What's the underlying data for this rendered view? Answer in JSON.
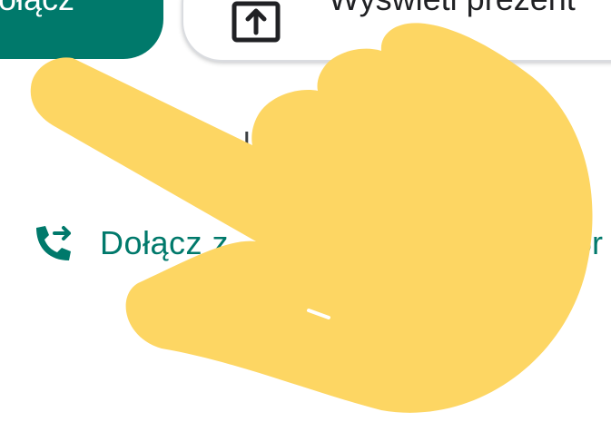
{
  "join_button": {
    "label": "ołącz"
  },
  "present_button": {
    "label": "Wyświetl prezent",
    "icon": "present-screen-icon"
  },
  "divider": {
    "text": "l"
  },
  "phone_join": {
    "label": "Dołącz z",
    "tail": "or",
    "icon": "phone-forward-icon"
  },
  "overlay": {
    "icon": "pointing-hand-icon",
    "color": "#fdd663"
  },
  "colors": {
    "accent": "#00796b",
    "text": "#202124",
    "border": "#dadce0"
  }
}
